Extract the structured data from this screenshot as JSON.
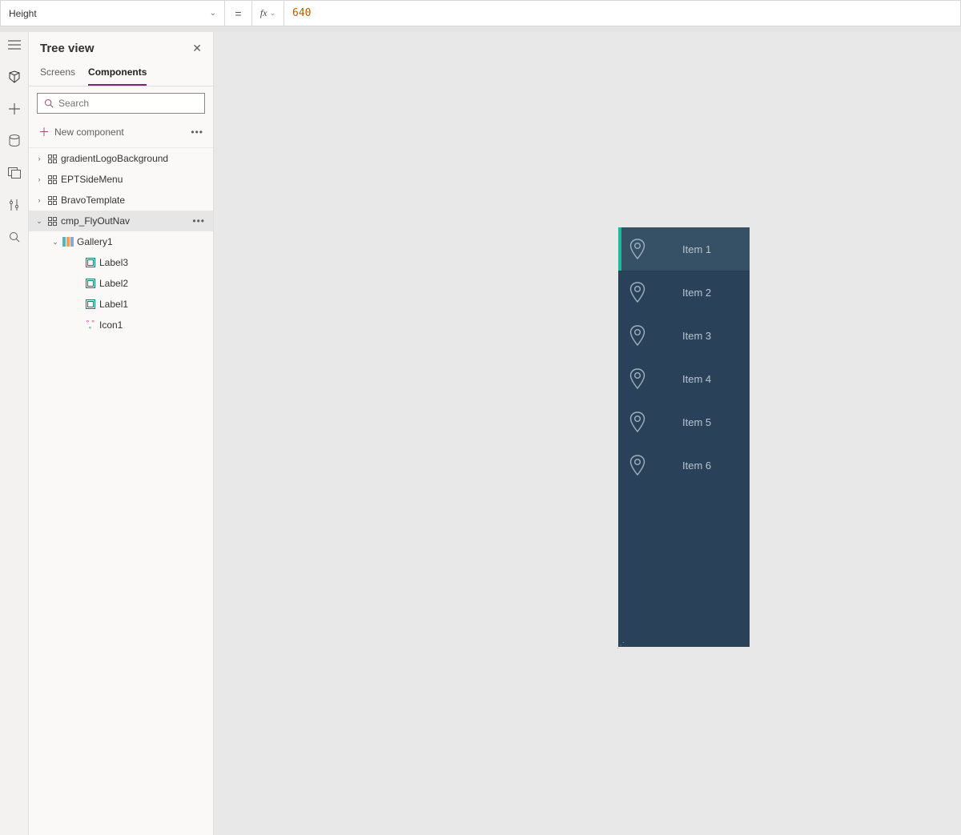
{
  "formula": {
    "property": "Height",
    "equals": "=",
    "fx": "fx",
    "value": "640"
  },
  "treeview": {
    "title": "Tree view",
    "tabs": {
      "screens": "Screens",
      "components": "Components"
    },
    "search_placeholder": "Search",
    "new_component": "New component",
    "items": {
      "gradientLogo": "gradientLogoBackground",
      "eptSideMenu": "EPTSideMenu",
      "bravoTemplate": "BravoTemplate",
      "flyOutNav": "cmp_FlyOutNav",
      "gallery1": "Gallery1",
      "label3": "Label3",
      "label2": "Label2",
      "label1": "Label1",
      "icon1": "Icon1"
    }
  },
  "preview": {
    "items": [
      "Item 1",
      "Item 2",
      "Item 3",
      "Item 4",
      "Item 5",
      "Item 6"
    ]
  }
}
